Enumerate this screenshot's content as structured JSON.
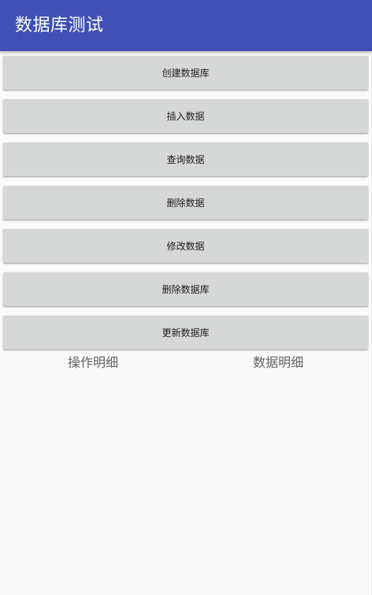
{
  "app_bar": {
    "title": "数据库测试",
    "color": "#3f51b5"
  },
  "buttons": [
    {
      "id": "create-db",
      "label": "创建数据库"
    },
    {
      "id": "insert-data",
      "label": "插入数据"
    },
    {
      "id": "query-data",
      "label": "查询数据"
    },
    {
      "id": "delete-data",
      "label": "删除数据"
    },
    {
      "id": "update-data",
      "label": "修改数据"
    },
    {
      "id": "delete-db",
      "label": "删除数据库"
    },
    {
      "id": "upgrade-db",
      "label": "更新数据库"
    }
  ],
  "details": {
    "operation_label": "操作明细",
    "data_label": "数据明细"
  }
}
